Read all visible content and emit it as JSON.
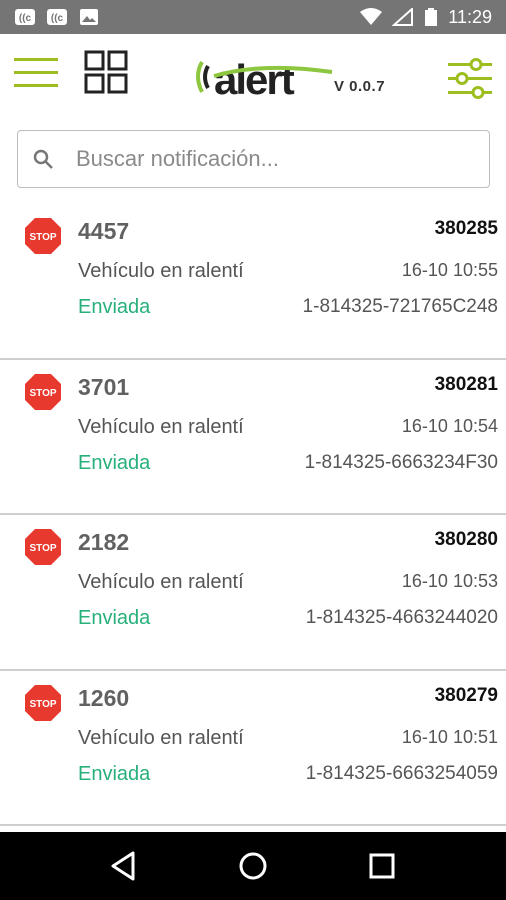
{
  "status_bar": {
    "time": "11:29",
    "icons": [
      "cast-icon",
      "cast-icon",
      "image-icon",
      "wifi-icon",
      "signal-icon",
      "battery-icon"
    ]
  },
  "header": {
    "logo_text": "alert",
    "version": "V 0.0.7",
    "brand_color": "#8dc63f"
  },
  "search": {
    "placeholder": "Buscar notificación...",
    "value": ""
  },
  "notifications": [
    {
      "code": "4457",
      "id": "380285",
      "description": "Vehículo en ralentí",
      "time": "16-10 10:55",
      "status": "Enviada",
      "reference": "1-814325-721765C248"
    },
    {
      "code": "3701",
      "id": "380281",
      "description": "Vehículo en ralentí",
      "time": "16-10 10:54",
      "status": "Enviada",
      "reference": "1-814325-6663234F30"
    },
    {
      "code": "2182",
      "id": "380280",
      "description": "Vehículo en ralentí",
      "time": "16-10 10:53",
      "status": "Enviada",
      "reference": "1-814325-4663244020"
    },
    {
      "code": "1260",
      "id": "380279",
      "description": "Vehículo en ralentí",
      "time": "16-10 10:51",
      "status": "Enviada",
      "reference": "1-814325-6663254059"
    }
  ],
  "stop_label": "STOP",
  "colors": {
    "status_green": "#27b07a",
    "stop_red": "#e8392f",
    "menu_green": "#9cbe1e"
  }
}
